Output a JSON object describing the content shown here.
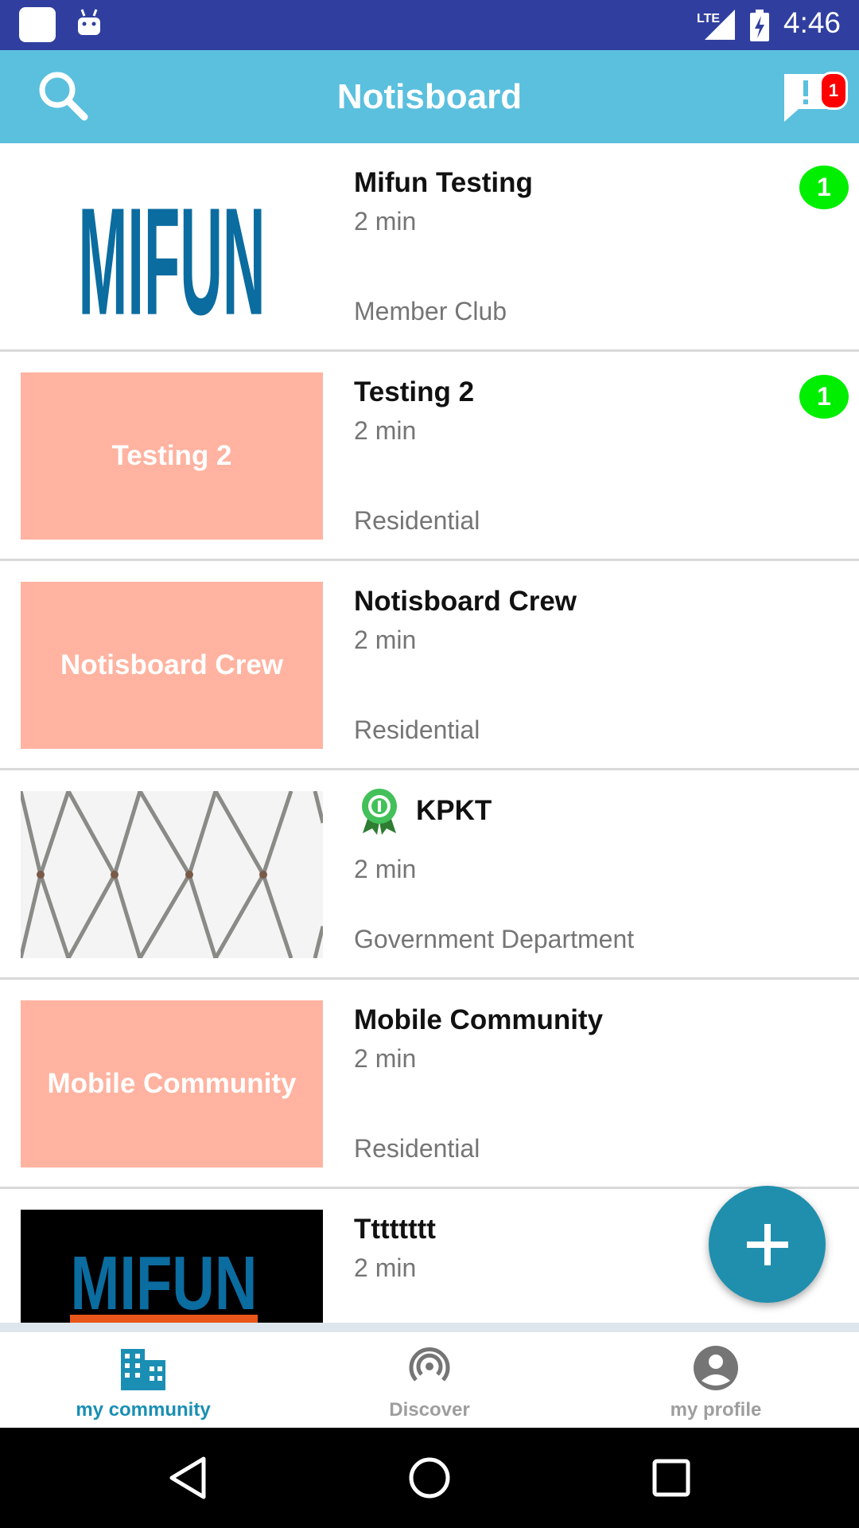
{
  "status_bar": {
    "time": "4:46",
    "network": "LTE",
    "icons": [
      "app-icon",
      "android-icon",
      "lte-signal-icon",
      "battery-charging-icon"
    ]
  },
  "app_bar": {
    "title": "Notisboard",
    "notification_count": "1",
    "background": "#5bc0de"
  },
  "communities": [
    {
      "title": "Mifun Testing",
      "time": "2 min",
      "category": "Member Club",
      "unread": "1",
      "thumb_type": "logo-mifun",
      "thumb_logo_text": "MIFUN"
    },
    {
      "title": "Testing 2",
      "time": "2 min",
      "category": "Residential",
      "unread": "1",
      "thumb_type": "placeholder",
      "thumb_text": "Testing 2"
    },
    {
      "title": "Notisboard Crew",
      "time": "2 min",
      "category": "Residential",
      "unread": "",
      "thumb_type": "placeholder",
      "thumb_text": "Notisboard Crew"
    },
    {
      "title": "KPKT",
      "time": "2 min",
      "category": "Government Department",
      "unread": "",
      "thumb_type": "fence-photo",
      "verified_icon": "award-ribbon-icon"
    },
    {
      "title": "Mobile Community",
      "time": "2 min",
      "category": "Residential",
      "unread": "",
      "thumb_type": "placeholder",
      "thumb_text": "Mobile Community"
    },
    {
      "title": "Tttttttt",
      "time": "2 min",
      "category": "",
      "unread": "",
      "thumb_type": "logo-mifun-network",
      "thumb_logo_text": "MIFUN"
    }
  ],
  "fab": {
    "icon": "plus-icon"
  },
  "bottom_nav": {
    "items": [
      {
        "label": "my community",
        "icon": "building-icon",
        "active": true
      },
      {
        "label": "Discover",
        "icon": "broadcast-icon",
        "active": false
      },
      {
        "label": "my profile",
        "icon": "account-circle-icon",
        "active": false
      }
    ]
  },
  "colors": {
    "status_bar": "#303f9f",
    "placeholder_thumb": "#ffb3a0",
    "unread_badge": "#00ee00",
    "fab": "#1f8fad",
    "active_nav": "#1a8fb3"
  }
}
